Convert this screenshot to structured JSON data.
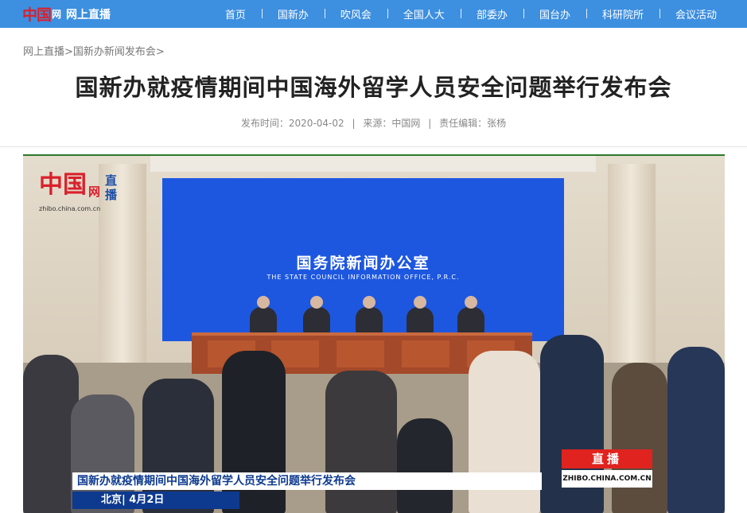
{
  "header": {
    "logo_mark": "中国",
    "logo_sub": "网",
    "logo_text": "网上直播",
    "nav": [
      "首页",
      "国新办",
      "吹风会",
      "全国人大",
      "部委办",
      "国台办",
      "科研院所",
      "会议活动"
    ]
  },
  "breadcrumb": [
    "网上直播>",
    "国新办新闻发布会>"
  ],
  "article": {
    "title": "国新办就疫情期间中国海外留学人员安全问题举行发布会",
    "meta": {
      "time": "发布时间：2020-04-02",
      "source": "来源：中国网",
      "editor": "责任编辑：张杨",
      "separator": "|"
    }
  },
  "video": {
    "watermark_logo": "中国",
    "watermark_wang": "网",
    "watermark_live": "直播",
    "watermark_url": "zhibo.china.com.cn",
    "screen_cn": "国务院新闻办公室",
    "screen_en": "THE STATE COUNCIL INFORMATION OFFICE, P.R.C.",
    "caption": "国新办就疫情期间中国海外留学人员安全问题举行发布会",
    "caption_date": "北京| 4月2日",
    "live_badge": "直播",
    "live_url": "ZHIBO.CHINA.COM.CN"
  },
  "colors": {
    "topbar": "#3d8fe0",
    "brand_red": "#d9212c",
    "screen_blue": "#1d57e0",
    "caption_blue": "#0d3a8f"
  }
}
